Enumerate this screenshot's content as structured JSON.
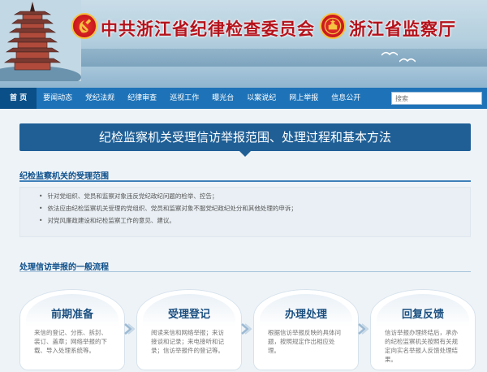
{
  "header": {
    "title_left": "中共浙江省纪律检查委员会",
    "title_right": "浙江省监察厅",
    "party_emblem_icon": "party-emblem-icon",
    "state_emblem_icon": "national-emblem-icon"
  },
  "nav": {
    "items": [
      {
        "label": "首 页",
        "active": true
      },
      {
        "label": "要闻动态"
      },
      {
        "label": "党纪法规"
      },
      {
        "label": "纪律审查"
      },
      {
        "label": "巡视工作"
      },
      {
        "label": "曝光台"
      },
      {
        "label": "以案说纪"
      },
      {
        "label": "网上举报"
      },
      {
        "label": "信息公开"
      }
    ],
    "search_placeholder": "搜索"
  },
  "main": {
    "page_title": "纪检监察机关受理信访举报范围、处理过程和基本方法",
    "scope": {
      "heading": "纪检监察机关的受理范围",
      "items": [
        "针对党组织、党员和监察对象违反党纪政纪问题的检举、控告；",
        "依法应由纪检监察机关受理的党组织、党员和监察对象不服党纪政纪处分和其他处理的申诉；",
        "对党风廉政建设和纪检监察工作的意见、建议。"
      ]
    },
    "process": {
      "heading": "处理信访举报的一般流程",
      "steps": [
        {
          "title": "前期准备",
          "desc": "来信的登记、分拣、拆封、装订、盖章；网络举报的下载、导入处理系统等。"
        },
        {
          "title": "受理登记",
          "desc": "阅读来信和网络举报；来访接谈和记录；来电接听和记录；信访举报件的登记等。"
        },
        {
          "title": "办理处理",
          "desc": "根据信访举报反映的具体问题，按照规定作出相应处理。"
        },
        {
          "title": "回复反馈",
          "desc": "信访举报办理终结后，承办的纪检监察机关按照有关规定向实名举报人反馈处理结果。"
        }
      ]
    }
  },
  "colors": {
    "nav_bg": "#1e73b8",
    "title_bar": "#1f5f96",
    "title_red": "#b5121b"
  }
}
